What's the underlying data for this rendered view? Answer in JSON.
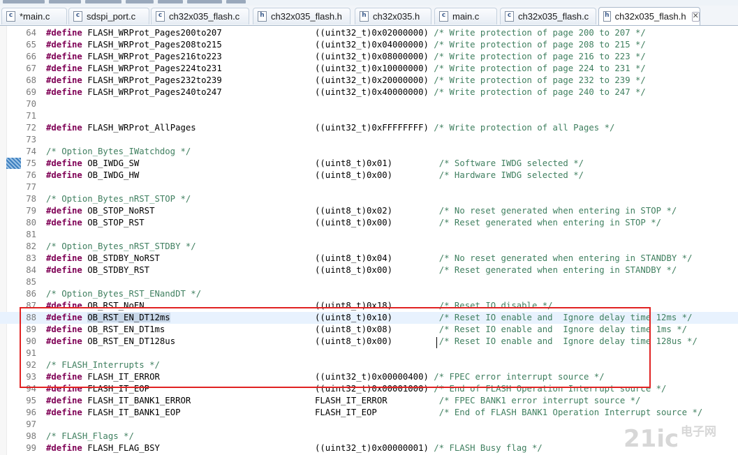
{
  "tabs": [
    {
      "name": "main-c-modified",
      "label": "*main.c",
      "icon": "c"
    },
    {
      "name": "sdspi-port-c",
      "label": "sdspi_port.c",
      "icon": "c"
    },
    {
      "name": "ch32x035-flash-c",
      "label": "ch32x035_flash.c",
      "icon": "c"
    },
    {
      "name": "ch32x035-flash-h",
      "label": "ch32x035_flash.h",
      "icon": "h"
    },
    {
      "name": "ch32x035-h",
      "label": "ch32x035.h",
      "icon": "h"
    },
    {
      "name": "main-c",
      "label": "main.c",
      "icon": "c"
    },
    {
      "name": "ch32x035-flash-c-2",
      "label": "ch32x035_flash.c",
      "icon": "c"
    },
    {
      "name": "ch32x035-flash-h-active",
      "label": "ch32x035_flash.h",
      "icon": "h",
      "active": true,
      "close": "✕"
    }
  ],
  "lines": [
    {
      "n": "64",
      "kw": "#define",
      "name": "FLASH_WRProt_Pages200to207",
      "val": "((uint32_t)0x02000000)",
      "cm": "/* Write protection of page 200 to 207 */"
    },
    {
      "n": "65",
      "kw": "#define",
      "name": "FLASH_WRProt_Pages208to215",
      "val": "((uint32_t)0x04000000)",
      "cm": "/* Write protection of page 208 to 215 */"
    },
    {
      "n": "66",
      "kw": "#define",
      "name": "FLASH_WRProt_Pages216to223",
      "val": "((uint32_t)0x08000000)",
      "cm": "/* Write protection of page 216 to 223 */"
    },
    {
      "n": "67",
      "kw": "#define",
      "name": "FLASH_WRProt_Pages224to231",
      "val": "((uint32_t)0x10000000)",
      "cm": "/* Write protection of page 224 to 231 */"
    },
    {
      "n": "68",
      "kw": "#define",
      "name": "FLASH_WRProt_Pages232to239",
      "val": "((uint32_t)0x20000000)",
      "cm": "/* Write protection of page 232 to 239 */"
    },
    {
      "n": "69",
      "kw": "#define",
      "name": "FLASH_WRProt_Pages240to247",
      "val": "((uint32_t)0x40000000)",
      "cm": "/* Write protection of page 240 to 247 */"
    },
    {
      "n": "70"
    },
    {
      "n": "71"
    },
    {
      "n": "72",
      "kw": "#define",
      "name": "FLASH_WRProt_AllPages",
      "val": "((uint32_t)0xFFFFFFFF)",
      "cm": "/* Write protection of all Pages */"
    },
    {
      "n": "73"
    },
    {
      "n": "74",
      "cmOnly": "/* Option_Bytes_IWatchdog */"
    },
    {
      "n": "75",
      "kw": "#define",
      "name": "OB_IWDG_SW",
      "val": "((uint8_t)0x01)",
      "cm": "/* Software IWDG selected */"
    },
    {
      "n": "76",
      "kw": "#define",
      "name": "OB_IWDG_HW",
      "val": "((uint8_t)0x00)",
      "cm": "/* Hardware IWDG selected */"
    },
    {
      "n": "77"
    },
    {
      "n": "78",
      "cmOnly": "/* Option_Bytes_nRST_STOP */"
    },
    {
      "n": "79",
      "kw": "#define",
      "name": "OB_STOP_NoRST",
      "val": "((uint8_t)0x02)",
      "cm": "/* No reset generated when entering in STOP */"
    },
    {
      "n": "80",
      "kw": "#define",
      "name": "OB_STOP_RST",
      "val": "((uint8_t)0x00)",
      "cm": "/* Reset generated when entering in STOP */"
    },
    {
      "n": "81"
    },
    {
      "n": "82",
      "cmOnly": "/* Option_Bytes_nRST_STDBY */"
    },
    {
      "n": "83",
      "kw": "#define",
      "name": "OB_STDBY_NoRST",
      "val": "((uint8_t)0x04)",
      "cm": "/* No reset generated when entering in STANDBY */"
    },
    {
      "n": "84",
      "kw": "#define",
      "name": "OB_STDBY_RST",
      "val": "((uint8_t)0x00)",
      "cm": "/* Reset generated when entering in STANDBY */"
    },
    {
      "n": "85"
    },
    {
      "n": "86",
      "cmOnly": "/* Option_Bytes_RST_ENandDT */"
    },
    {
      "n": "87",
      "kw": "#define",
      "name": "OB_RST_NoEN",
      "val": "((uint8_t)0x18)",
      "cm": "/* Reset IO disable */"
    },
    {
      "n": "88",
      "kw": "#define",
      "name": "OB_RST_EN_DT12ms",
      "val": "((uint8_t)0x10)",
      "cm": "/* Reset IO enable and  Ignore delay time 12ms */",
      "highlight": true
    },
    {
      "n": "89",
      "kw": "#define",
      "name": "OB_RST_EN_DT1ms",
      "val": "((uint8_t)0x08)",
      "cm": "/* Reset IO enable and  Ignore delay time 1ms */"
    },
    {
      "n": "90",
      "kw": "#define",
      "name": "OB_RST_EN_DT128us",
      "val": "((uint8_t)0x00)",
      "cm": "/* Reset IO enable and  Ignore delay time 128us */"
    },
    {
      "n": "91"
    },
    {
      "n": "92",
      "cmOnly": "/* FLASH_Interrupts */"
    },
    {
      "n": "93",
      "kw": "#define",
      "name": "FLASH_IT_ERROR",
      "val": "((uint32_t)0x00000400)",
      "cm": "/* FPEC error interrupt source */"
    },
    {
      "n": "94",
      "kw": "#define",
      "name": "FLASH_IT_EOP",
      "val": "((uint32_t)0x00001000)",
      "cm": "/* End of FLASH Operation Interrupt source */"
    },
    {
      "n": "95",
      "kw": "#define",
      "name": "FLASH_IT_BANK1_ERROR",
      "val": "FLASH_IT_ERROR",
      "cm": "/* FPEC BANK1 error interrupt source */"
    },
    {
      "n": "96",
      "kw": "#define",
      "name": "FLASH_IT_BANK1_EOP",
      "val": "FLASH_IT_EOP",
      "cm": "/* End of FLASH BANK1 Operation Interrupt source */"
    },
    {
      "n": "97"
    },
    {
      "n": "98",
      "cmOnly": "/* FLASH_Flags */"
    },
    {
      "n": "99",
      "kw": "#define",
      "name": "FLASH_FLAG_BSY",
      "val": "((uint32_t)0x00000001)",
      "cm": "/* FLASH Busy flag */"
    }
  ],
  "watermark": {
    "brand": "21ic",
    "cn": "电子网"
  }
}
